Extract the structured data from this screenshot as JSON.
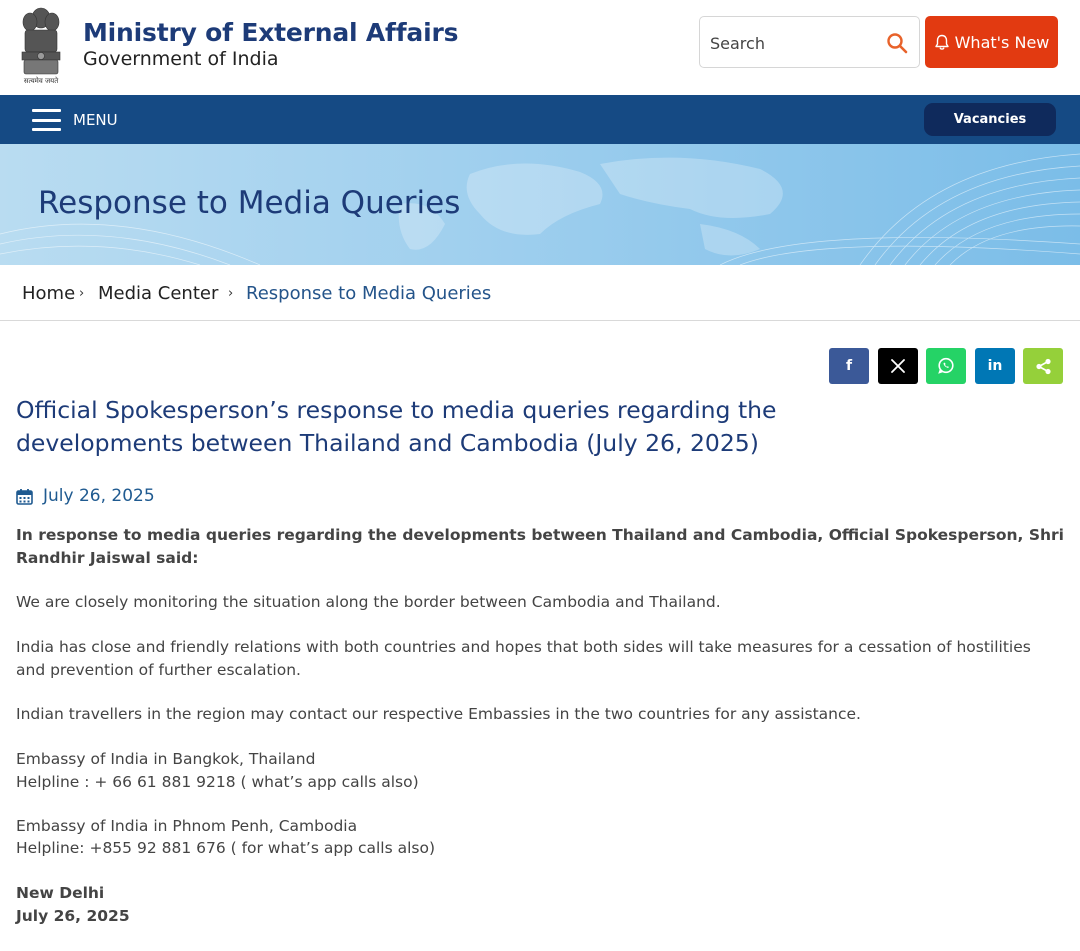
{
  "header": {
    "title": "Ministry of External Affairs",
    "subtitle": "Government of India",
    "emblem_motto": "सत्यमेव जयते",
    "search_placeholder": "Search",
    "whats_new_label": "What's New",
    "colors": {
      "title": "#1d3b78",
      "whats_new_bg": "#e23a11",
      "search_icon": "#e8622a"
    }
  },
  "nav": {
    "menu_label": "MENU",
    "vacancies_label": "Vacancies",
    "colors": {
      "bar": "#154a84",
      "vacancies_bg": "#0f2a5c"
    }
  },
  "banner": {
    "title": "Response to Media Queries"
  },
  "breadcrumb": {
    "items": [
      "Home",
      "Media Center",
      "Response to Media Queries"
    ],
    "separator": "›"
  },
  "share": {
    "buttons": [
      {
        "icon": "facebook-icon",
        "glyph": "f",
        "color": "#3b5998"
      },
      {
        "icon": "x-icon",
        "glyph": "𝕏",
        "color": "#000000"
      },
      {
        "icon": "whatsapp-icon",
        "glyph": "",
        "color": "#25d366"
      },
      {
        "icon": "linkedin-icon",
        "glyph": "in",
        "color": "#0077b5"
      },
      {
        "icon": "share-icon",
        "glyph": "",
        "color": "#95d03a"
      }
    ]
  },
  "article": {
    "title": "Official Spokesperson’s response to media queries regarding the developments between Thailand and Cambodia (July 26, 2025)",
    "date": "July 26, 2025",
    "lead": "In response to media queries regarding the developments between Thailand and Cambodia, Official Spokesperson, Shri Randhir Jaiswal said:",
    "paragraphs": [
      "We are closely monitoring the situation along the border between Cambodia and Thailand.",
      "India has close and friendly relations with both countries and hopes that both sides will take measures for a cessation of hostilities and prevention of further escalation.",
      "Indian travellers in the region may contact our respective Embassies in the two countries for any assistance."
    ],
    "contacts": [
      {
        "name": "Embassy of India in Bangkok, Thailand",
        "helpline": "Helpline : + 66 61 881 9218 ( what’s app calls also)"
      },
      {
        "name": "Embassy of India in Phnom Penh, Cambodia",
        "helpline": "Helpline: +855 92 881 676 ( for what’s app calls also)"
      }
    ],
    "place": "New Delhi",
    "signoff_date": "July 26, 2025"
  }
}
